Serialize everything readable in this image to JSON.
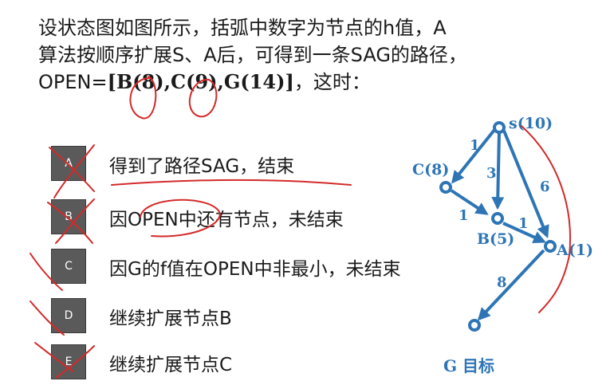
{
  "question": {
    "line1": "设状态图如图所示，括弧中数字为节点的h值，A",
    "line2": "算法按顺序扩展S、A后，可得到一条SAG的路径，",
    "line3_prefix": "OPEN=",
    "line3_set": "[B(8),C(9),G(14)]",
    "line3_suffix": "，这时："
  },
  "options": [
    {
      "letter": "A",
      "text": "得到了路径SAG，结束"
    },
    {
      "letter": "B",
      "text": "因OPEN中还有节点，未结束"
    },
    {
      "letter": "C",
      "text": "因G的f值在OPEN中非最小，未结束"
    },
    {
      "letter": "D",
      "text": "继续扩展节点B"
    },
    {
      "letter": "E",
      "text": "继续扩展节点C"
    }
  ],
  "graph": {
    "accent_color": "#2e75b6",
    "annotation_color": "#d42a2a",
    "nodes": {
      "s": "s(10)",
      "c": "C(8)",
      "b": "B(5)",
      "a": "A(1)",
      "g": "G 目标"
    },
    "edges": {
      "s_c": "1",
      "s_b": "3",
      "s_a": "6",
      "c_b": "1",
      "b_a": "1",
      "a_g": "8"
    }
  }
}
